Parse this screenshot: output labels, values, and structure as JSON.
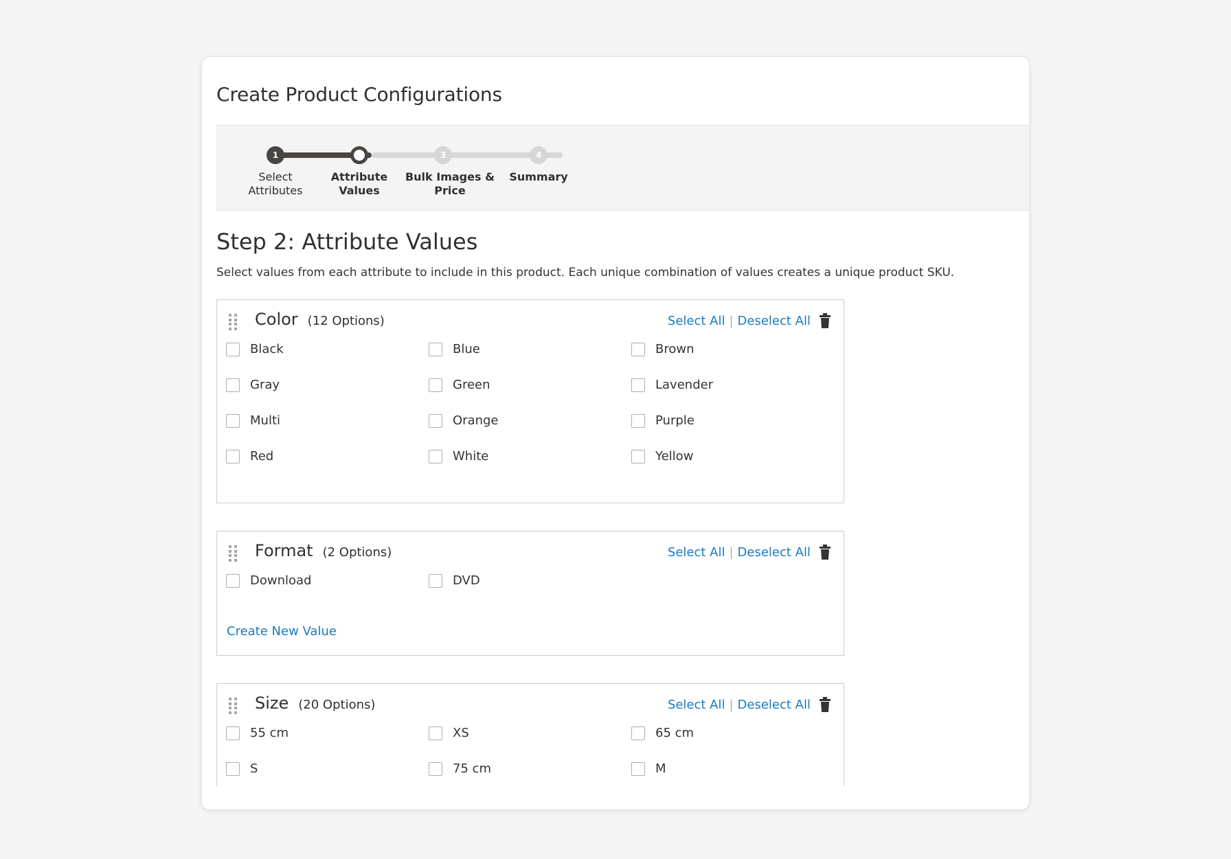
{
  "modal": {
    "title": "Create Product Configurations"
  },
  "wizard": {
    "steps": [
      {
        "number": "1",
        "label_line1": "Select",
        "label_line2": "Attributes",
        "state": "done"
      },
      {
        "number": "2",
        "label_line1": "Attribute",
        "label_line2": "Values",
        "state": "current"
      },
      {
        "number": "3",
        "label_line1": "Bulk Images &",
        "label_line2": "Price",
        "state": "todo"
      },
      {
        "number": "4",
        "label_line1": "Summary",
        "label_line2": "",
        "state": "todo"
      }
    ]
  },
  "step": {
    "heading": "Step 2: Attribute Values",
    "description": "Select values from each attribute to include in this product. Each unique combination of values creates a unique product SKU."
  },
  "actions": {
    "select_all": "Select All",
    "separator": "|",
    "deselect_all": "Deselect All",
    "create_new": "Create New Value"
  },
  "attributes": [
    {
      "name": "Color",
      "count": "(12 Options)",
      "options": [
        "Black",
        "Blue",
        "Brown",
        "Gray",
        "Green",
        "Lavender",
        "Multi",
        "Orange",
        "Purple",
        "Red",
        "White",
        "Yellow"
      ]
    },
    {
      "name": "Format",
      "count": "(2 Options)",
      "options": [
        "Download",
        "DVD"
      ]
    },
    {
      "name": "Size",
      "count": "(20 Options)",
      "options": [
        "55 cm",
        "XS",
        "65 cm",
        "S",
        "75 cm",
        "M"
      ]
    }
  ],
  "colors": {
    "link": "#1979c3",
    "progress_done": "#4a4542",
    "progress_todo": "#d6d6d6"
  },
  "icons": {
    "trash": "trash-icon",
    "grip": "drag-handle-icon"
  }
}
